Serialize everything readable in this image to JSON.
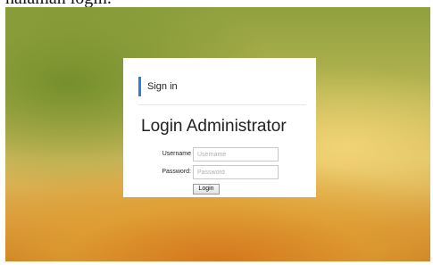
{
  "caption": "halaman login.",
  "panel": {
    "signin_label": "Sign in",
    "title": "Login Administrator",
    "username_label": "Username",
    "username_placeholder": "Username",
    "password_label": "Password",
    "password_placeholder": "Password",
    "login_button": "Login"
  },
  "colors": {
    "accent": "#2f7fd0",
    "panel_background": "#ffffff"
  }
}
